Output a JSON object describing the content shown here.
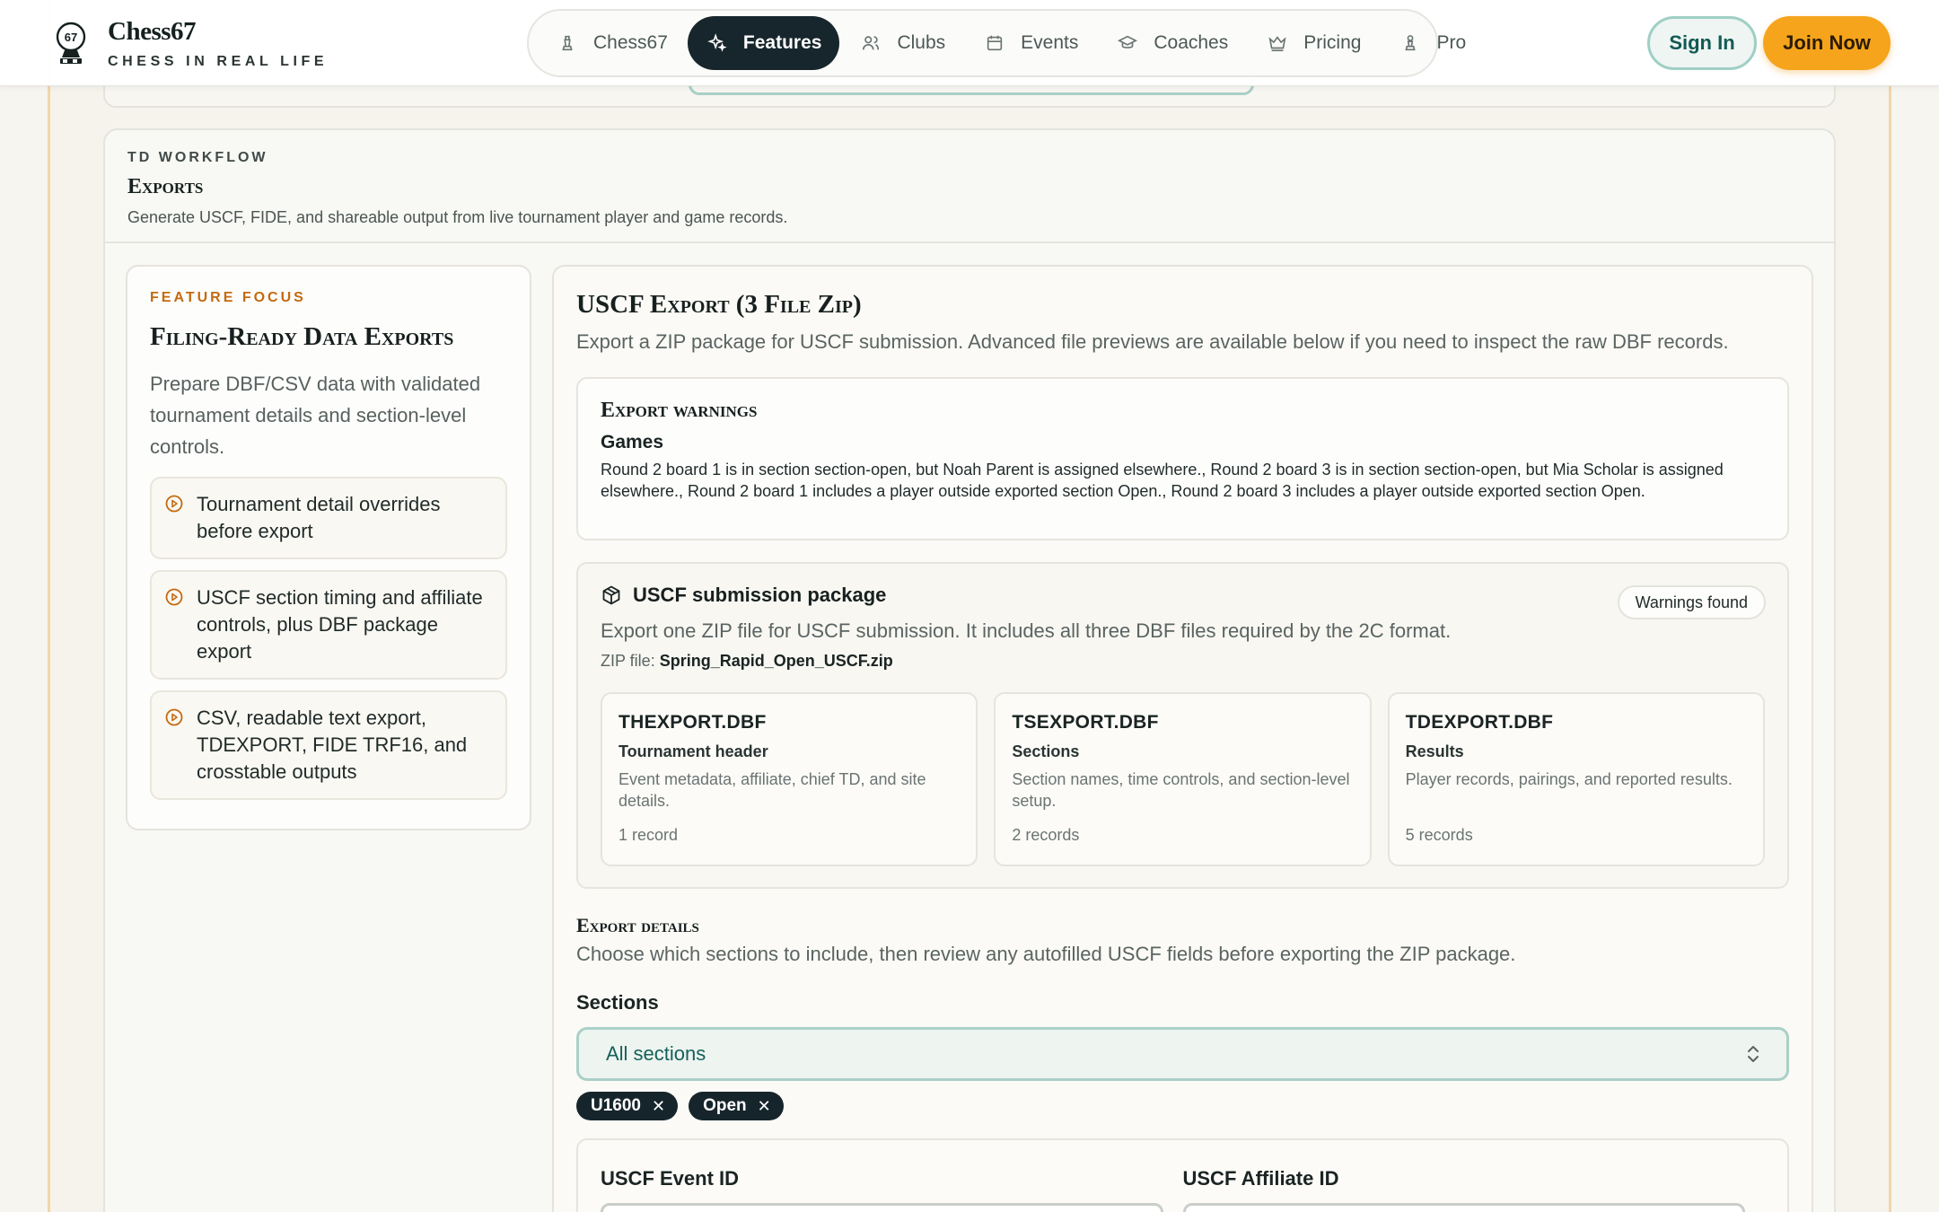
{
  "brand": {
    "name": "Chess67",
    "tagline": "CHESS IN REAL LIFE",
    "logo_text": "67"
  },
  "nav": {
    "items": [
      {
        "label": "Chess67",
        "icon": "pawn-icon",
        "active": false
      },
      {
        "label": "Features",
        "icon": "sparkle-icon",
        "active": true
      },
      {
        "label": "Clubs",
        "icon": "users-icon",
        "active": false
      },
      {
        "label": "Events",
        "icon": "calendar-icon",
        "active": false
      },
      {
        "label": "Coaches",
        "icon": "graduation-cap-icon",
        "active": false
      },
      {
        "label": "Pricing",
        "icon": "crown-icon",
        "active": false
      },
      {
        "label": "Pro",
        "icon": "pawn-icon",
        "active": false
      }
    ],
    "sign_in": "Sign In",
    "join_now": "Join Now"
  },
  "workflow": {
    "kicker": "TD WORKFLOW",
    "title": "Exports",
    "description": "Generate USCF, FIDE, and shareable output from live tournament player and game records."
  },
  "focus": {
    "kicker": "FEATURE FOCUS",
    "title": "Filing-Ready Data Exports",
    "description": "Prepare DBF/CSV data with validated tournament details and section-level controls.",
    "items": [
      "Tournament detail overrides before export",
      "USCF section timing and affiliate controls, plus DBF package export",
      "CSV, readable text export, TDEXPORT, FIDE TRF16, and crosstable outputs"
    ]
  },
  "main": {
    "title": "USCF Export (3 File Zip)",
    "subtitle": "Export a ZIP package for USCF submission. Advanced file previews are available below if you need to inspect the raw DBF records.",
    "warnings": {
      "title": "Export warnings",
      "category": "Games",
      "text": "Round 2 board 1 is in section section-open, but Noah Parent is assigned elsewhere., Round 2 board 3 is in section section-open, but Mia Scholar is assigned elsewhere., Round 2 board 1 includes a player outside exported section Open., Round 2 board 3 includes a player outside exported section Open."
    },
    "package": {
      "title": "USCF submission package",
      "badge": "Warnings found",
      "description": "Export one ZIP file for USCF submission. It includes all three DBF files required by the 2C format.",
      "zip_label": "ZIP file:",
      "zip_name": "Spring_Rapid_Open_USCF.zip",
      "files": [
        {
          "name": "THEXPORT.DBF",
          "label": "Tournament header",
          "desc": "Event metadata, affiliate, chief TD, and site details.",
          "count": "1 record"
        },
        {
          "name": "TSEXPORT.DBF",
          "label": "Sections",
          "desc": "Section names, time controls, and section-level setup.",
          "count": "2 records"
        },
        {
          "name": "TDEXPORT.DBF",
          "label": "Results",
          "desc": "Player records, pairings, and reported results.",
          "count": "5 records"
        }
      ]
    },
    "details": {
      "title": "Export details",
      "subtitle": "Choose which sections to include, then review any autofilled USCF fields before exporting the ZIP package.",
      "sections_label": "Sections",
      "sections_value": "All sections",
      "chips": [
        "U1600",
        "Open"
      ],
      "event_id_label": "USCF Event ID",
      "affiliate_id_label": "USCF Affiliate ID"
    }
  },
  "colors": {
    "accent_orange": "#f5a41c",
    "nav_active": "#17262c",
    "teal": "#15625a"
  }
}
